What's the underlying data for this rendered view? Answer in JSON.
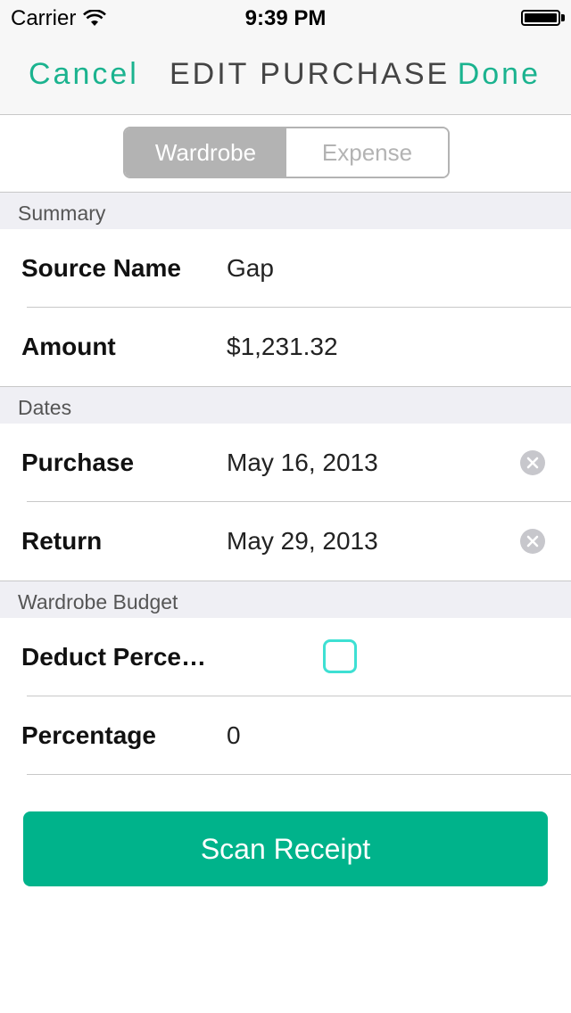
{
  "status_bar": {
    "carrier": "Carrier",
    "time": "9:39 PM"
  },
  "nav": {
    "cancel_label": "Cancel",
    "title": "EDIT PURCHASE",
    "done_label": "Done"
  },
  "segments": {
    "items": [
      "Wardrobe",
      "Expense"
    ],
    "selected": "Wardrobe"
  },
  "sections": [
    {
      "header": "Summary",
      "rows": [
        {
          "label": "Source Name",
          "value": "Gap"
        },
        {
          "label": "Amount",
          "value": "$1,231.32"
        }
      ]
    },
    {
      "header": "Dates",
      "rows": [
        {
          "label": "Purchase",
          "value": "May 16, 2013"
        },
        {
          "label": "Return",
          "value": "May 29, 2013"
        }
      ]
    },
    {
      "header": "Wardrobe Budget",
      "rows": [
        {
          "label": "Deduct Perce…",
          "value": "",
          "checked": false
        },
        {
          "label": "Percentage",
          "value": "0"
        }
      ]
    }
  ],
  "scan_button_label": "Scan Receipt",
  "colors": {
    "accent": "#1bb38f",
    "button": "#00b38b",
    "checkbox_border": "#3ee0d3",
    "segment_active": "#b3b3b3"
  },
  "icons": {
    "wifi": "wifi-icon",
    "battery": "battery-icon",
    "clear": "clear-circle-icon"
  }
}
